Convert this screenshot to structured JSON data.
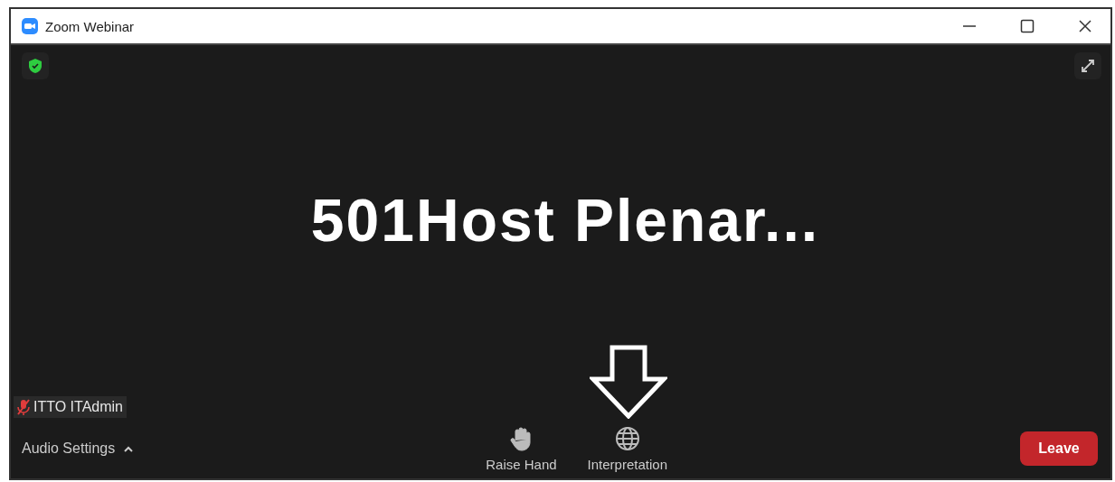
{
  "window": {
    "title": "Zoom Webinar"
  },
  "meeting_title": "501Host Plenar...",
  "name_tag": {
    "name": "ITTO ITAdmin",
    "muted": true
  },
  "toolbar": {
    "audio_settings": "Audio Settings",
    "items": [
      {
        "kind": "raise-hand",
        "label": "Raise Hand"
      },
      {
        "kind": "interpretation",
        "label": "Interpretation"
      }
    ],
    "leave": "Leave"
  },
  "annotation": {
    "kind": "down-arrow"
  }
}
